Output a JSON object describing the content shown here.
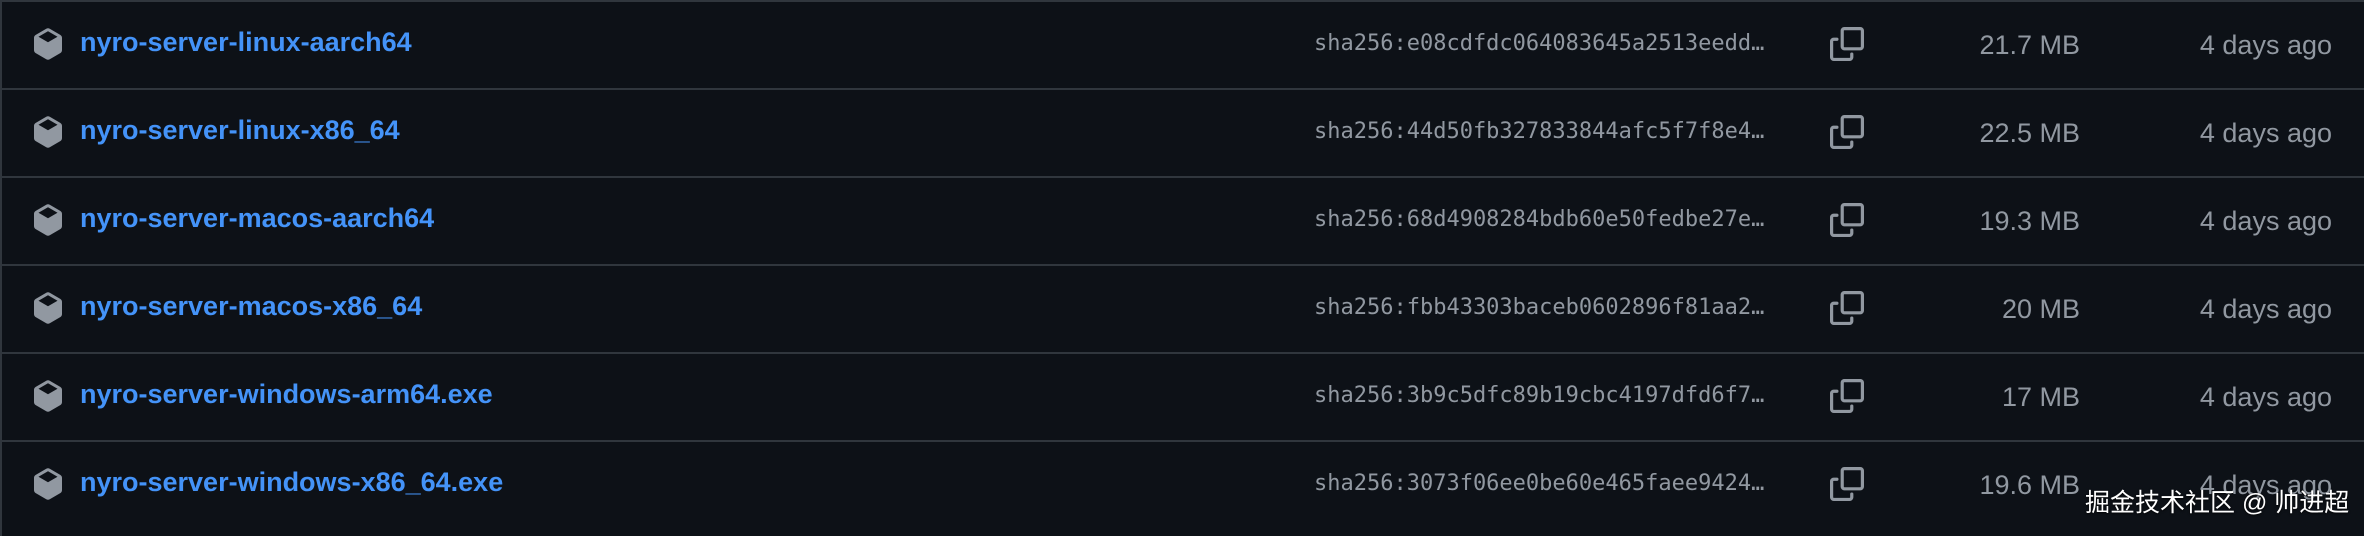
{
  "assets": [
    {
      "name": "nyro-server-linux-aarch64",
      "digest": "sha256:e08cdfdc064083645a2513eedd…",
      "size": "21.7 MB",
      "date": "4 days ago"
    },
    {
      "name": "nyro-server-linux-x86_64",
      "digest": "sha256:44d50fb327833844afc5f7f8e4…",
      "size": "22.5 MB",
      "date": "4 days ago"
    },
    {
      "name": "nyro-server-macos-aarch64",
      "digest": "sha256:68d4908284bdb60e50fedbe27e…",
      "size": "19.3 MB",
      "date": "4 days ago"
    },
    {
      "name": "nyro-server-macos-x86_64",
      "digest": "sha256:fbb43303baceb0602896f81aa2…",
      "size": "20 MB",
      "date": "4 days ago"
    },
    {
      "name": "nyro-server-windows-arm64.exe",
      "digest": "sha256:3b9c5dfc89b19cbc4197dfd6f7…",
      "size": "17 MB",
      "date": "4 days ago"
    },
    {
      "name": "nyro-server-windows-x86_64.exe",
      "digest": "sha256:3073f06ee0be60e465faee9424…",
      "size": "19.6 MB",
      "date": "4 days ago"
    }
  ],
  "watermark": "掘金技术社区 @ 帅进超",
  "icons": {
    "asset": "package-icon",
    "copy": "copy-icon"
  },
  "colors": {
    "background": "#0d1117",
    "border": "#30363d",
    "link": "#4493f8",
    "muted": "#9198a1"
  }
}
